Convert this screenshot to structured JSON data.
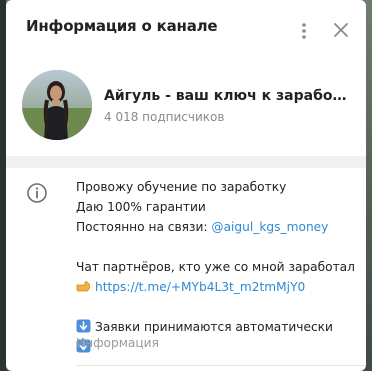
{
  "dialog": {
    "title": "Информация о канале",
    "menu_icon": "more-vertical-icon",
    "close_icon": "close-icon"
  },
  "channel": {
    "name": "Айгуль - ваш ключ к заработк...",
    "subscribers": "4 018 подписчиков",
    "avatar": "avatar"
  },
  "info": {
    "icon": "info-icon",
    "line1": "Провожу обучение по заработку",
    "line2": "Даю 100% гарантии",
    "line3_prefix": "Постоянно на связи: ",
    "line3_link": "@aigul_kgs_money",
    "line4": "Чат партнёров, кто уже со мной заработал",
    "line5_link": "https://t.me/+MYb4L3t_m2tmMjY0",
    "line6": "Заявки принимаются автоматически",
    "caption": "Информация"
  },
  "colors": {
    "link": "#2f8ad5",
    "muted": "#8a8a8a",
    "accent_emoji": "#4a90d9",
    "pointing_hand": "#f5b041"
  }
}
